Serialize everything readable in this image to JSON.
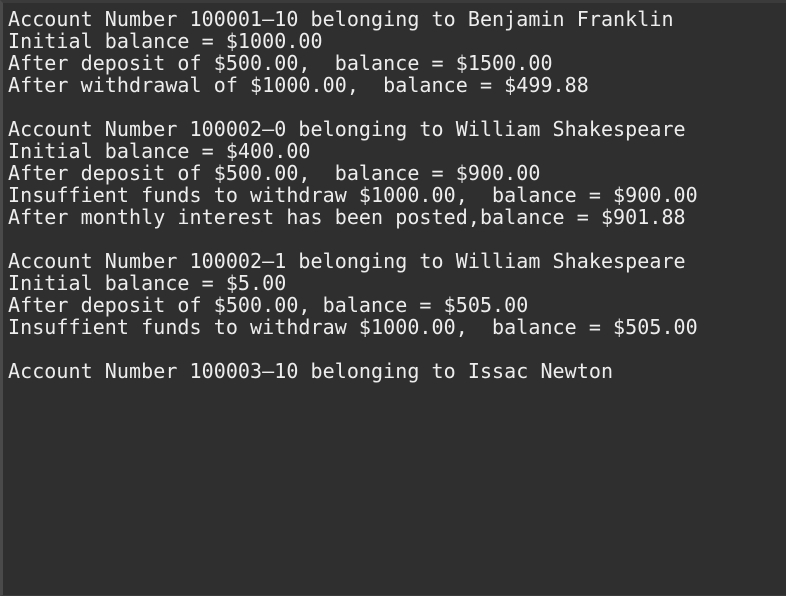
{
  "theme": {
    "background": "#2f2f2f",
    "text": "#ededed"
  },
  "output": {
    "lines": [
      "Account Number 100001–10 belonging to Benjamin Franklin",
      "Initial balance = $1000.00",
      "After deposit of $500.00,  balance = $1500.00",
      "After withdrawal of $1000.00,  balance = $499.88",
      "",
      "Account Number 100002–0 belonging to William Shakespeare",
      "Initial balance = $400.00",
      "After deposit of $500.00,  balance = $900.00",
      "Insuffient funds to withdraw $1000.00,  balance = $900.00",
      "After monthly interest has been posted,balance = $901.88",
      "",
      "Account Number 100002–1 belonging to William Shakespeare",
      "Initial balance = $5.00",
      "After deposit of $500.00, balance = $505.00",
      "Insuffient funds to withdraw $1000.00,  balance = $505.00",
      "",
      "Account Number 100003–10 belonging to Issac Newton"
    ]
  }
}
